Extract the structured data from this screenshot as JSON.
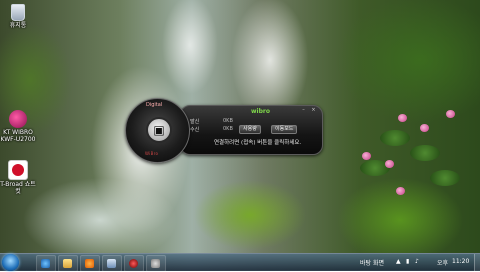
{
  "desktop": {
    "icons": [
      {
        "label": "휴지통"
      },
      {
        "label": "KT WIBRO KWF-U2700"
      },
      {
        "label": "T-Broad 쇼트컷"
      }
    ]
  },
  "widget": {
    "logo_text": "Digital",
    "dial_center": "▣",
    "dial_sub": "WiBro",
    "brand": "wibro",
    "window_controls": {
      "minimize": "–",
      "close": "×"
    },
    "rows": [
      {
        "label": "발신",
        "value": "0KB"
      },
      {
        "label": "수신",
        "value": "0KB"
      }
    ],
    "buttons": {
      "connect": "사용량",
      "disconnect": "이동모드"
    },
    "status_text": "연결하려면 (접속) 버튼을 클릭하세요."
  },
  "taskbar": {
    "desktop_toggle": "바탕 화면",
    "ampm": "오후",
    "time": "11:20"
  },
  "colors": {
    "brand_green": "#7fd84a",
    "accent_red": "#ff3a3a"
  }
}
